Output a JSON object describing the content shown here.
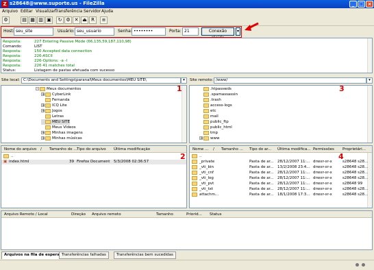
{
  "title": "s28648@www.suporte.us - FileZilla",
  "menu": [
    "Arquivo",
    "Editar",
    "Visualizar",
    "Transferência",
    "Servidor",
    "Ajuda"
  ],
  "quickconnect": {
    "host_label": "Host:",
    "host_value": "seu_site",
    "user_label": "Usuário:",
    "user_value": "seu_usuario",
    "pass_label": "Senha:",
    "pass_value": "••••••••",
    "port_label": "Porta:",
    "port_value": "21",
    "button": "Conexão rápida"
  },
  "log": [
    {
      "label": "Resposta:",
      "msg": "227 Entering Passive Mode (66,135,59,187,110,98)",
      "color": "#008000"
    },
    {
      "label": "Comando:",
      "msg": "LIST",
      "color": "#000000"
    },
    {
      "label": "Resposta:",
      "msg": "150 Accepted data connection",
      "color": "#008000"
    },
    {
      "label": "Resposta:",
      "msg": "226-ASCII",
      "color": "#008000"
    },
    {
      "label": "Resposta:",
      "msg": "226-Options: -a -l",
      "color": "#008000"
    },
    {
      "label": "Resposta:",
      "msg": "226 41 matches total",
      "color": "#008000"
    },
    {
      "label": "Status:",
      "msg": "Listagem de pastas efetuada com sucesso",
      "color": "#000000"
    }
  ],
  "local": {
    "label": "Site local:",
    "path": "C:\\Documents and Settings\\paranal\\Meus documentos\\MEU SITE\\",
    "tree": [
      {
        "name": "Meus documentos",
        "level": 0,
        "exp": "-"
      },
      {
        "name": "CyberLink",
        "level": 1,
        "exp": "+"
      },
      {
        "name": "Fernanda",
        "level": 1,
        "exp": ""
      },
      {
        "name": "ICQ Lite",
        "level": 1,
        "exp": "+"
      },
      {
        "name": "Jogos",
        "level": 1,
        "exp": "+"
      },
      {
        "name": "Letras",
        "level": 1,
        "exp": ""
      },
      {
        "name": "MEU SITE",
        "level": 1,
        "exp": ""
      },
      {
        "name": "Meus Vídeos",
        "level": 1,
        "exp": ""
      },
      {
        "name": "Minhas imagens",
        "level": 1,
        "exp": "+"
      },
      {
        "name": "Minhas músicas",
        "level": 1,
        "exp": "+"
      }
    ],
    "headers": [
      "Nome do arquivo",
      "/",
      "Tamanho do ...",
      "Tipo do arquivo",
      "Última modificação"
    ],
    "files": [
      {
        "name": "..",
        "size": "",
        "type": "",
        "date": ""
      },
      {
        "name": "index.html",
        "size": "39",
        "type": "Firefox Document",
        "date": "5/3/2008 02:36:57"
      }
    ]
  },
  "remote": {
    "label": "Site remoto:",
    "path": "/www/",
    "tree": [
      {
        "name": ".htpasswds",
        "exp": ""
      },
      {
        "name": ".spamassassin",
        "exp": ""
      },
      {
        "name": ".trash",
        "exp": ""
      },
      {
        "name": "access-logs",
        "exp": ""
      },
      {
        "name": "etc",
        "exp": ""
      },
      {
        "name": "mail",
        "exp": ""
      },
      {
        "name": "public_ftp",
        "exp": ""
      },
      {
        "name": "public_html",
        "exp": ""
      },
      {
        "name": "tmp",
        "exp": ""
      },
      {
        "name": "www",
        "exp": "+"
      }
    ],
    "headers": [
      "Nome ...",
      "/",
      "Tamanho ...",
      "Tipo do ar...",
      "Última modifica...",
      "Permissões",
      "Proprietári..."
    ],
    "files": [
      {
        "name": "..",
        "size": "",
        "type": "",
        "date": "",
        "perm": "",
        "owner": ""
      },
      {
        "name": "_private",
        "size": "",
        "type": "Pasta de ar...",
        "date": "28/12/2007 11:...",
        "perm": "drwxr-xr-x",
        "owner": "s28648 s28..."
      },
      {
        "name": "_vti_bin",
        "size": "",
        "type": "Pasta de ar...",
        "date": "13/2/2008 23:4...",
        "perm": "drwxr-xr-x",
        "owner": "s28648 s28..."
      },
      {
        "name": "_vti_cnf",
        "size": "",
        "type": "Pasta de ar...",
        "date": "28/12/2007 11:...",
        "perm": "drwxr-xr-x",
        "owner": "s28648 s28..."
      },
      {
        "name": "_vti_log",
        "size": "",
        "type": "Pasta de ar...",
        "date": "28/12/2007 11:...",
        "perm": "drwxr-xr-x",
        "owner": "s28648 s28..."
      },
      {
        "name": "_vti_pvt",
        "size": "",
        "type": "Pasta de ar...",
        "date": "28/12/2007 11:...",
        "perm": "drwxr-xr-x",
        "owner": "s28648 99"
      },
      {
        "name": "_vti_txt",
        "size": "",
        "type": "Pasta de ar...",
        "date": "28/12/2007 11:...",
        "perm": "drwxr-xr-x",
        "owner": "s28648 s28..."
      },
      {
        "name": "attachm...",
        "size": "",
        "type": "Pasta de ar...",
        "date": "18/1/2008 17:3...",
        "perm": "drwxr-xr-x",
        "owner": "s28648 s28..."
      }
    ]
  },
  "queue": {
    "headers": [
      "Arquivo Remoto / Local",
      "Direção",
      "Arquivo remoto",
      "Tamanho",
      "Priorid...",
      "Status"
    ],
    "tabs": [
      "Arquivos na fila de espera",
      "Transferências falhadas",
      "Transferências bem sucedidas"
    ]
  },
  "markers": [
    "1",
    "2",
    "3",
    "4"
  ],
  "colors": {
    "title_bar": "#0b4fd8",
    "marker": "#e00000",
    "success": "#008000"
  }
}
